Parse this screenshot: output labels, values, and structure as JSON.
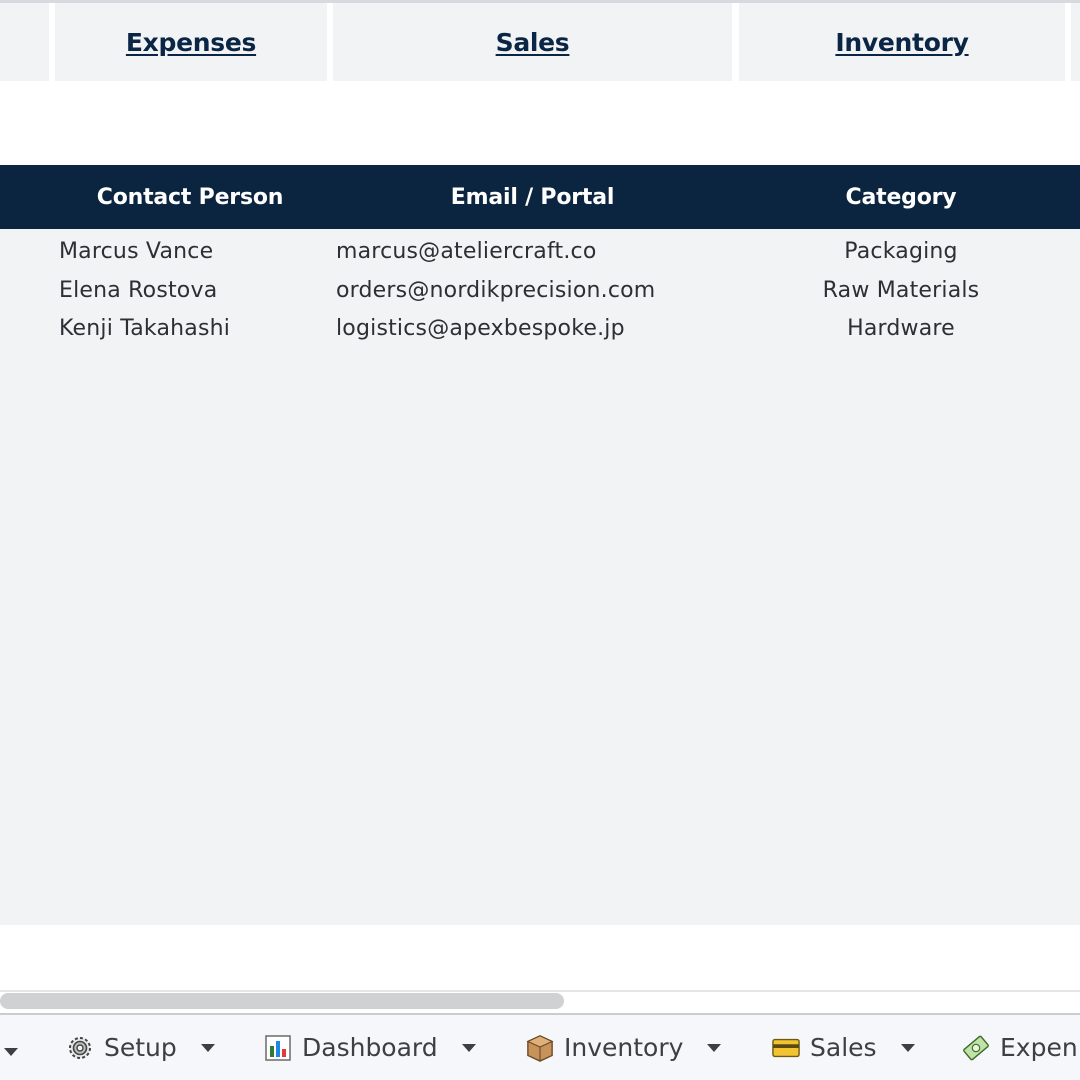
{
  "nav": {
    "links": [
      "Expenses",
      "Sales",
      "Inventory"
    ]
  },
  "table": {
    "headers": [
      "Contact Person",
      "Email / Portal",
      "Category"
    ],
    "rows": [
      {
        "contact": "Marcus Vance",
        "email": "marcus@ateliercraft.co",
        "category": "Packaging"
      },
      {
        "contact": "Elena Rostova",
        "email": "orders@nordikprecision.com",
        "category": "Raw Materials"
      },
      {
        "contact": "Kenji Takahashi",
        "email": "logistics@apexbespoke.jp",
        "category": "Hardware"
      }
    ]
  },
  "sheet_tabs": [
    {
      "label": "Setup",
      "icon": "gear-icon"
    },
    {
      "label": "Dashboard",
      "icon": "bar-chart-icon"
    },
    {
      "label": "Inventory",
      "icon": "package-icon"
    },
    {
      "label": "Sales",
      "icon": "credit-card-icon"
    },
    {
      "label": "Expen",
      "icon": "money-icon"
    }
  ],
  "colors": {
    "header_bg": "#0b2540",
    "nav_link": "#0b2545",
    "panel_bg": "#f2f3f5"
  }
}
